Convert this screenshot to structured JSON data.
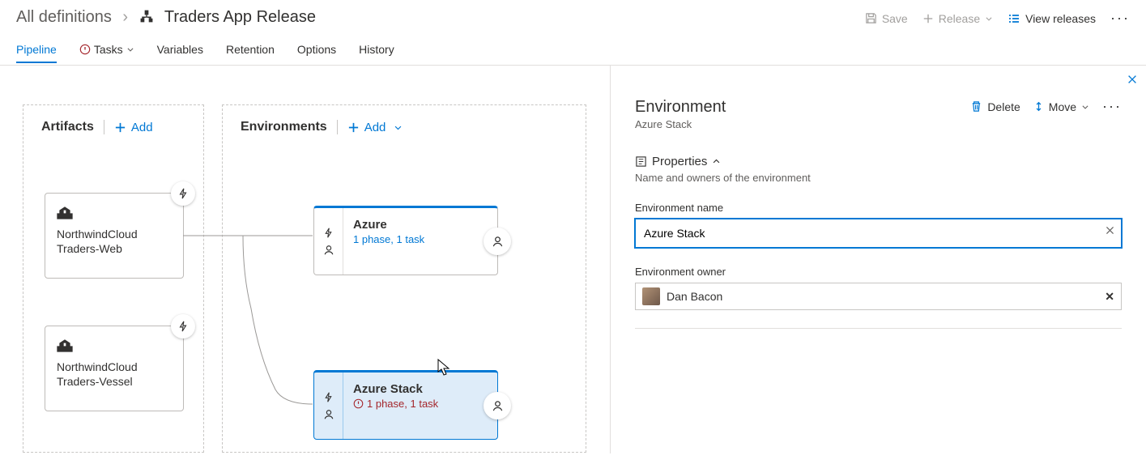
{
  "breadcrumb": {
    "root": "All definitions",
    "title": "Traders App Release"
  },
  "headerCmds": {
    "save": "Save",
    "release": "Release",
    "view": "View releases"
  },
  "tabs": {
    "pipeline": "Pipeline",
    "tasks": "Tasks",
    "variables": "Variables",
    "retention": "Retention",
    "options": "Options",
    "history": "History"
  },
  "columns": {
    "artifacts": "Artifacts",
    "environments": "Environments",
    "add": "Add"
  },
  "artifacts": {
    "a1": "NorthwindCloud Traders-Web",
    "a2": "NorthwindCloud Traders-Vessel"
  },
  "envs": {
    "e1": {
      "name": "Azure",
      "sub": "1 phase, 1 task"
    },
    "e2": {
      "name": "Azure Stack",
      "sub": "1 phase, 1 task"
    }
  },
  "panel": {
    "title": "Environment",
    "subtitle": "Azure Stack",
    "delete": "Delete",
    "move": "Move",
    "propsHeader": "Properties",
    "propsSub": "Name and owners of the environment",
    "nameLabel": "Environment name",
    "nameValue": "Azure Stack",
    "ownerLabel": "Environment owner",
    "ownerName": "Dan Bacon"
  }
}
